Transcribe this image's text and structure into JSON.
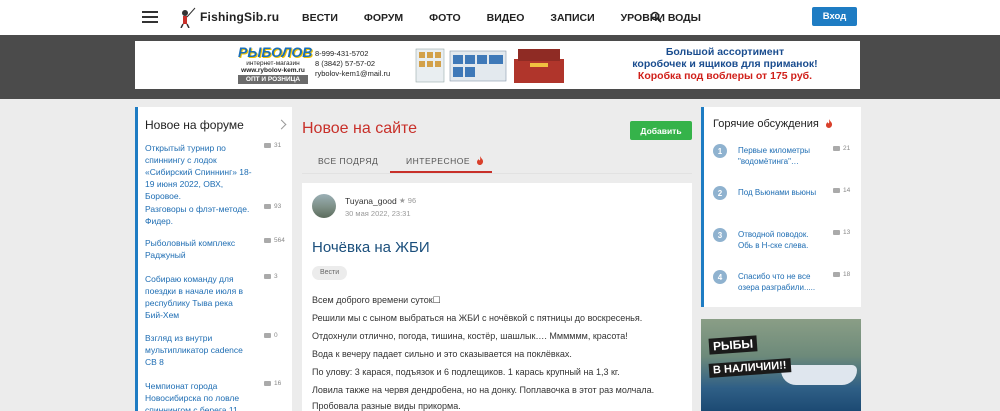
{
  "header": {
    "logo_text": "FishingSib.ru",
    "nav": [
      "ВЕСТИ",
      "ФОРУМ",
      "ФОТО",
      "ВИДЕО",
      "ЗАПИСИ",
      "УРОВНИ ВОДЫ"
    ],
    "login_label": "Вход"
  },
  "banner": {
    "logo_title": "РЫБОЛОВ",
    "logo_sub": "интернет-магазин",
    "logo_site": "www.rybolov-kem.ru",
    "logo_bar": "ОПТ И РОЗНИЦА",
    "phone1": "8-999-431-5702",
    "phone2": "8 (3842) 57-57-02",
    "email": "rybolov-kem1@mail.ru",
    "line1": "Большой ассортимент",
    "line2": "коробочек и ящиков для приманок!",
    "line3": "Коробка под воблеры от 175 руб."
  },
  "left": {
    "title": "Новое на форуме",
    "items": [
      {
        "title": "Открытый турнир по спиннингу с лодок «Сибирский Спиннинг» 18-19 июня 2022, ОВХ, Боровое.",
        "count": "31"
      },
      {
        "title": "Разговоры о флэт-методе. Фидер.",
        "count": "93"
      },
      {
        "title": "Рыболовный комплекс Раджуный",
        "count": "564"
      },
      {
        "title": "Собираю команду для поездки в начале июля в республику Тыва река Бий-Хем",
        "count": "3"
      },
      {
        "title": "Взгляд из внутри мультипликатор cadence CB 8",
        "count": "0"
      },
      {
        "title": "Чемпионат города Новосибирска по ловле спиннингом с берега 11",
        "count": "16"
      }
    ]
  },
  "center": {
    "title": "Новое на сайте",
    "add_label": "Добавить",
    "tab_all": "ВСЕ ПОДРЯД",
    "tab_interesting": "ИНТЕРЕСНОЕ",
    "post": {
      "author": "Tuyana_good",
      "rating": "★ 96",
      "date": "30 мая 2022, 23:31",
      "title": "Ночёвка на ЖБИ",
      "tag": "Вести",
      "lines": [
        "Всем доброго времени суток☐",
        "Решили мы с сыном выбраться на ЖБИ с ночёвкой с пятницы до воскресенья.",
        "Отдохнули отлично, погода, тишина, костёр, шашлык…. Мммммм, красота!",
        "Вода к вечеру падает сильно и это сказывается на поклёвках.",
        "По улову: 3 карася, подъязок и 6 подлещиков. 1 карась крупный на 1,3 кг.",
        "Ловила также на червя дендробена, но на донку. Поплавочка в этот раз молчала.",
        "Пробовала разные виды прикорма."
      ]
    }
  },
  "right": {
    "title": "Горячие обсуждения",
    "items": [
      {
        "num": "1",
        "title": "Первые километры \"водомётинга\"…",
        "count": "21"
      },
      {
        "num": "2",
        "title": "Под Вьюнами вьюны",
        "count": "14"
      },
      {
        "num": "3",
        "title": "Отводной поводок. Обь в Н-ске слева.",
        "count": "13"
      },
      {
        "num": "4",
        "title": "Спасибо что не все озера разграбили.....",
        "count": "18"
      }
    ],
    "ad_line1": "РЫБЫ",
    "ad_line2": "В НАЛИЧИИ!!"
  },
  "colors": {
    "accent_blue": "#1e7cc3",
    "accent_red": "#c8302a",
    "add_green": "#35b34a"
  }
}
